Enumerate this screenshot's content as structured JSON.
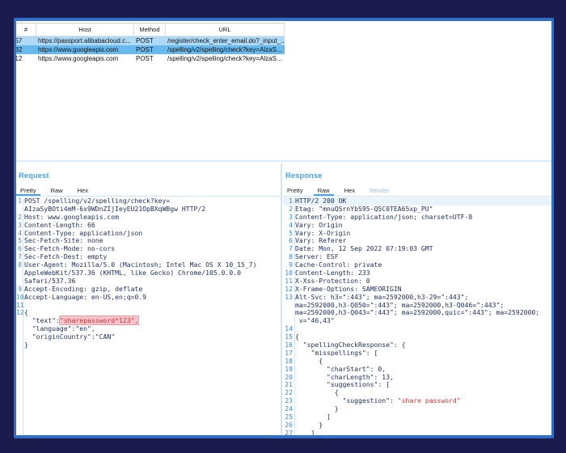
{
  "table": {
    "headers": [
      "#",
      "Host",
      "Method",
      "URL"
    ],
    "rows": [
      {
        "num": "357",
        "host": "https://passport.alibabacloud.c...",
        "method": "POST",
        "url": "/register/check_enter_email.do?_input_...",
        "state": "sel1"
      },
      {
        "num": "332",
        "host": "https://www.googleapis.com",
        "method": "POST",
        "url": "/spelling/v2/spelling/check?key=AlzaS...",
        "state": "sel2"
      },
      {
        "num": "312",
        "host": "https://www.googleapis.com",
        "method": "POST",
        "url": "/spelling/v2/spelling/check?key=AlzaS...",
        "state": ""
      }
    ]
  },
  "request": {
    "title": "Request",
    "tabs": [
      {
        "label": "Pretty",
        "active": true
      },
      {
        "label": "Raw"
      },
      {
        "label": "Hex"
      }
    ],
    "lines": [
      {
        "n": "1",
        "s": [
          {
            "t": "POST /spelling/v2/spelling/check?key="
          }
        ]
      },
      {
        "n": "",
        "s": [
          {
            "t": "AIzaSyBOti4mM-6x9WDnZIjIeyEU21OpBXqWBgw HTTP/2"
          }
        ]
      },
      {
        "n": "2",
        "s": [
          {
            "t": "Host: www.googleapis.com"
          }
        ]
      },
      {
        "n": "3",
        "s": [
          {
            "t": "Content-Length: 66"
          }
        ]
      },
      {
        "n": "4",
        "s": [
          {
            "t": "Content-Type: application/json"
          }
        ]
      },
      {
        "n": "5",
        "s": [
          {
            "t": "Sec-Fetch-Site: none"
          }
        ]
      },
      {
        "n": "6",
        "s": [
          {
            "t": "Sec-Fetch-Mode: no-cors"
          }
        ]
      },
      {
        "n": "7",
        "s": [
          {
            "t": "Sec-Fetch-Dest: empty"
          }
        ]
      },
      {
        "n": "8",
        "s": [
          {
            "t": "User-Agent: Mozilla/5.0 (Macintosh; Intel Mac OS X 10_15_7)"
          }
        ]
      },
      {
        "n": "",
        "s": [
          {
            "t": "AppleWebKit/537.36 (KHTML, like Gecko) Chrome/105.0.0.0"
          }
        ]
      },
      {
        "n": "",
        "s": [
          {
            "t": "Safari/537.36"
          }
        ]
      },
      {
        "n": "9",
        "s": [
          {
            "t": "Accept-Encoding: gzip, deflate"
          }
        ]
      },
      {
        "n": "10",
        "s": [
          {
            "t": "Accept-Language: en-US,en;q=0.9"
          }
        ]
      },
      {
        "n": "11",
        "s": [
          {
            "t": ""
          }
        ]
      },
      {
        "n": "12",
        "s": [
          {
            "t": "{"
          }
        ]
      },
      {
        "n": "",
        "s": [
          {
            "t": "  \"text\":"
          },
          {
            "t": "\"sharepassword*123\",",
            "c": "mark"
          }
        ]
      },
      {
        "n": "",
        "s": [
          {
            "t": "  \"language\":\"en\","
          }
        ]
      },
      {
        "n": "",
        "s": [
          {
            "t": "  \"originCountry\":\"CAN\""
          }
        ]
      },
      {
        "n": "",
        "s": [
          {
            "t": "}"
          }
        ]
      }
    ]
  },
  "response": {
    "title": "Response",
    "tabs": [
      {
        "label": "Pretty"
      },
      {
        "label": "Raw",
        "active": true
      },
      {
        "label": "Hex"
      },
      {
        "label": "Render",
        "dim": true
      }
    ],
    "lines": [
      {
        "n": "1",
        "s": [
          {
            "t": "HTTP/2 200 OK"
          }
        ],
        "hl": true
      },
      {
        "n": "2",
        "s": [
          {
            "t": "Etag: \"mnuQSrnYbS95-Q5C0TEA65xp_PU\""
          }
        ]
      },
      {
        "n": "3",
        "s": [
          {
            "t": "Content-Type: application/json; charset=UTF-8"
          }
        ]
      },
      {
        "n": "4",
        "s": [
          {
            "t": "Vary: Origin"
          }
        ]
      },
      {
        "n": "5",
        "s": [
          {
            "t": "Vary: X-Origin"
          }
        ]
      },
      {
        "n": "6",
        "s": [
          {
            "t": "Vary: Referer"
          }
        ]
      },
      {
        "n": "7",
        "s": [
          {
            "t": "Date: Mon, 12 Sep 2022 07:19:03 GMT"
          }
        ]
      },
      {
        "n": "8",
        "s": [
          {
            "t": "Server: ESF"
          }
        ]
      },
      {
        "n": "9",
        "s": [
          {
            "t": "Cache-Control: private"
          }
        ]
      },
      {
        "n": "10",
        "s": [
          {
            "t": "Content-Length: 233"
          }
        ]
      },
      {
        "n": "11",
        "s": [
          {
            "t": "X-Xss-Protection: 0"
          }
        ]
      },
      {
        "n": "12",
        "s": [
          {
            "t": "X-Frame-Options: SAMEORIGIN"
          }
        ]
      },
      {
        "n": "13",
        "s": [
          {
            "t": "Alt-Svc: h3=\":443\"; ma=2592000,h3-29=\":443\";"
          }
        ]
      },
      {
        "n": "",
        "s": [
          {
            "t": "ma=2592000,h3-Q050=\":443\"; ma=2592000,h3-Q046=\":443\";"
          }
        ]
      },
      {
        "n": "",
        "s": [
          {
            "t": "ma=2592000,h3-Q043=\":443\"; ma=2592000,quic=\":443\"; ma=2592000;"
          }
        ]
      },
      {
        "n": "",
        "s": [
          {
            "t": " v=\"46,43\""
          }
        ]
      },
      {
        "n": "14",
        "s": [
          {
            "t": ""
          }
        ]
      },
      {
        "n": "15",
        "s": [
          {
            "t": "{"
          }
        ]
      },
      {
        "n": "16",
        "s": [
          {
            "t": "  \"spellingCheckResponse\": {"
          }
        ]
      },
      {
        "n": "17",
        "s": [
          {
            "t": "    \"misspellings\": ["
          }
        ]
      },
      {
        "n": "18",
        "s": [
          {
            "t": "      {"
          }
        ]
      },
      {
        "n": "19",
        "s": [
          {
            "t": "        \"charStart\": 0,"
          }
        ]
      },
      {
        "n": "20",
        "s": [
          {
            "t": "        \"charLength\": 13,"
          }
        ]
      },
      {
        "n": "21",
        "s": [
          {
            "t": "        \"suggestions\": ["
          }
        ]
      },
      {
        "n": "22",
        "s": [
          {
            "t": "          {"
          }
        ]
      },
      {
        "n": "23",
        "s": [
          {
            "t": "            \"suggestion\": "
          },
          {
            "t": "\"share password\"",
            "c": "str"
          }
        ]
      },
      {
        "n": "24",
        "s": [
          {
            "t": "          }"
          }
        ]
      },
      {
        "n": "25",
        "s": [
          {
            "t": "        ]"
          }
        ]
      },
      {
        "n": "26",
        "s": [
          {
            "t": "      }"
          }
        ]
      },
      {
        "n": "27",
        "s": [
          {
            "t": "    ]"
          }
        ]
      }
    ]
  },
  "colors": {
    "background": "#1b1b4d",
    "frame": "#2f6fc4",
    "accent": "#4aa3e8",
    "selected_row": "#68b9ee",
    "selected_row_light": "#aedaf7",
    "string": "#d63030"
  }
}
